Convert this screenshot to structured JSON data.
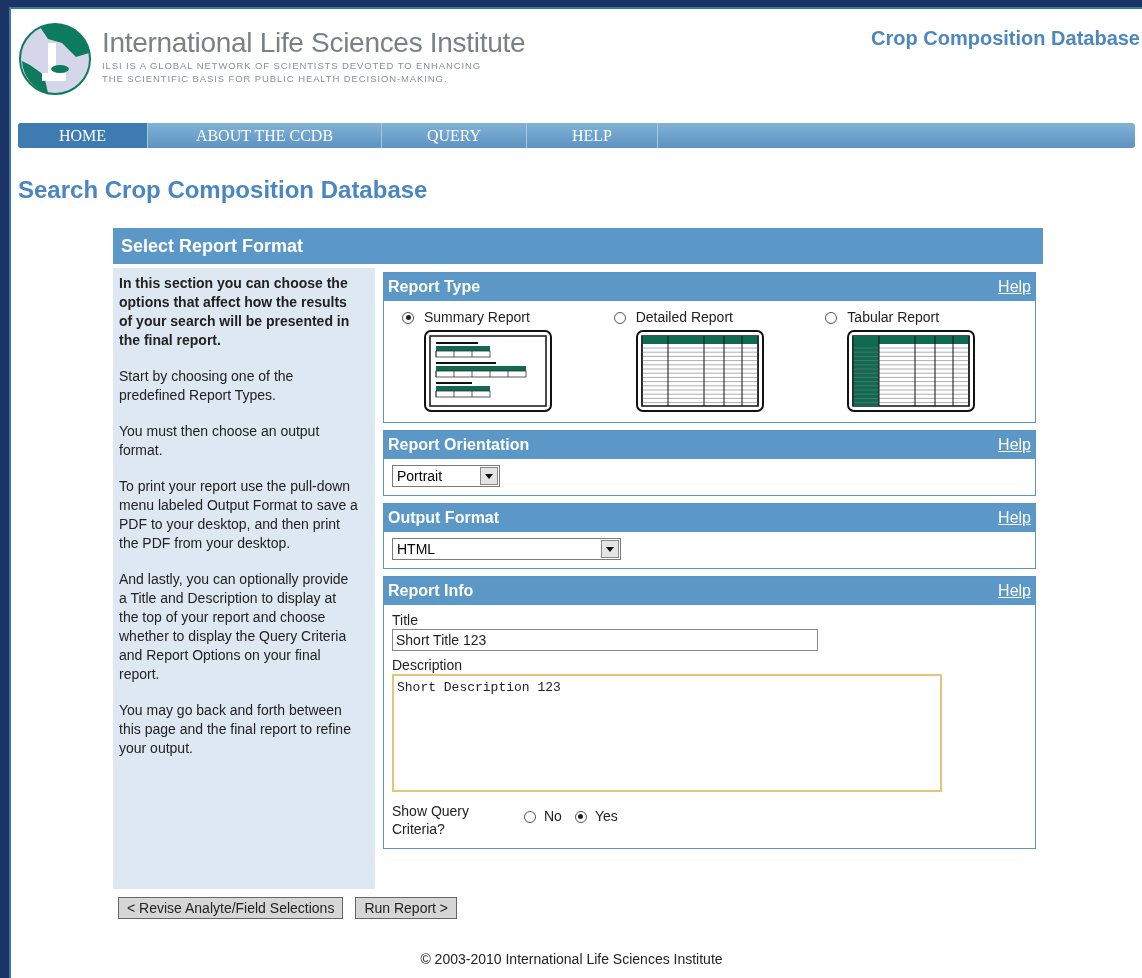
{
  "header": {
    "title": "International Life Sciences Institute",
    "tagline": [
      "ILSI IS A GLOBAL NETWORK OF SCIENTISTS DEVOTED TO ENHANCING",
      "THE SCIENTIFIC BASIS FOR PUBLIC HEALTH DECISION-MAKING."
    ],
    "site_name": "Crop Composition Database"
  },
  "nav": [
    {
      "label": "HOME",
      "selected": true
    },
    {
      "label": "ABOUT THE CCDB",
      "selected": false
    },
    {
      "label": "QUERY",
      "selected": false
    },
    {
      "label": "HELP",
      "selected": false
    }
  ],
  "page_title": "Search Crop Composition Database",
  "panel_title": "Select Report Format",
  "intro": [
    {
      "text": "In this section you can choose the options that affect how the results of your search will be presented in the final report.",
      "bold": true
    },
    {
      "text": "Start by choosing one of the predefined Report Types.",
      "bold": false
    },
    {
      "text": "You must then choose an output format.",
      "bold": false
    },
    {
      "text": "To print your report use the pull-down menu labeled Output Format to save a PDF to your desktop, and then print the PDF from your desktop.",
      "bold": false
    },
    {
      "text": "And lastly, you can optionally provide a Title and Description to display at the top of your report and choose whether to display the Query Criteria and Report Options on your final report.",
      "bold": false
    },
    {
      "text": "You may go back and forth between this page and the final report to refine your output.",
      "bold": false
    }
  ],
  "report_type": {
    "title": "Report Type",
    "help": "Help",
    "options": [
      {
        "label": "Summary Report",
        "kind": "summary",
        "selected": true
      },
      {
        "label": "Detailed Report",
        "kind": "detailed",
        "selected": false
      },
      {
        "label": "Tabular Report",
        "kind": "tabular",
        "selected": false
      }
    ]
  },
  "orientation": {
    "title": "Report Orientation",
    "help": "Help",
    "value": "Portrait"
  },
  "output_format": {
    "title": "Output Format",
    "help": "Help",
    "value": "HTML"
  },
  "report_info": {
    "title": "Report Info",
    "help": "Help",
    "title_label": "Title",
    "title_value": "Short Title 123",
    "description_label": "Description",
    "description_value": "Short Description 123",
    "show_query_label": "Show Query Criteria?",
    "show_query_options": [
      {
        "label": "No",
        "selected": false
      },
      {
        "label": "Yes",
        "selected": true
      }
    ]
  },
  "buttons": [
    "< Revise Analyte/Field Selections",
    "Run Report >"
  ],
  "footer": "© 2003-2010 International Life Sciences Institute"
}
